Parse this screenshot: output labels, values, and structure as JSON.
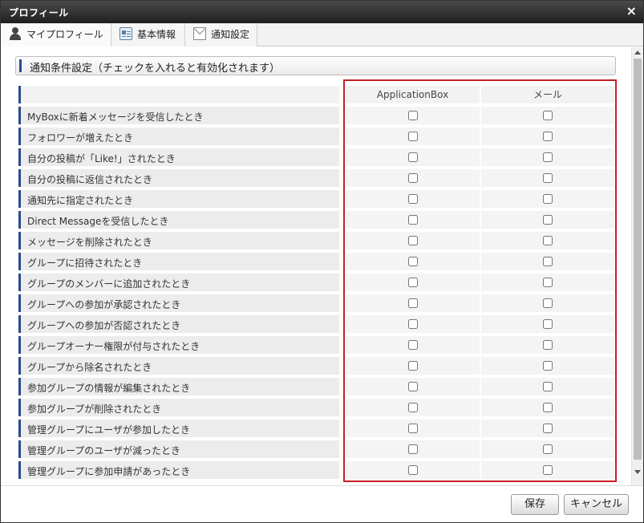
{
  "dialog": {
    "title": "プロフィール",
    "close_glyph": "×"
  },
  "tabs": [
    {
      "label": "マイプロフィール",
      "icon": "user-icon"
    },
    {
      "label": "基本情報",
      "icon": "id-card-icon"
    },
    {
      "label": "通知設定",
      "icon": "mail-icon"
    }
  ],
  "section": {
    "title": "通知条件設定（チェックを入れると有効化されます）"
  },
  "table": {
    "columns": [
      "ApplicationBox",
      "メール"
    ],
    "rows": [
      "MyBoxに新着メッセージを受信したとき",
      "フォロワーが増えたとき",
      "自分の投稿が「Like!」されたとき",
      "自分の投稿に返信されたとき",
      "通知先に指定されたとき",
      "Direct Messageを受信したとき",
      "メッセージを削除されたとき",
      "グループに招待されたとき",
      "グループのメンバーに追加されたとき",
      "グループへの参加が承認されたとき",
      "グループへの参加が否認されたとき",
      "グループオーナー権限が付与されたとき",
      "グループから除名されたとき",
      "参加グループの情報が編集されたとき",
      "参加グループが削除されたとき",
      "管理グループにユーザが参加したとき",
      "管理グループのユーザが減ったとき",
      "管理グループに参加申請があったとき"
    ]
  },
  "footer": {
    "save_label": "保存",
    "cancel_label": "キャンセル"
  },
  "colors": {
    "highlight_border": "#c71f24",
    "accent_bar": "#2c4a8c"
  }
}
